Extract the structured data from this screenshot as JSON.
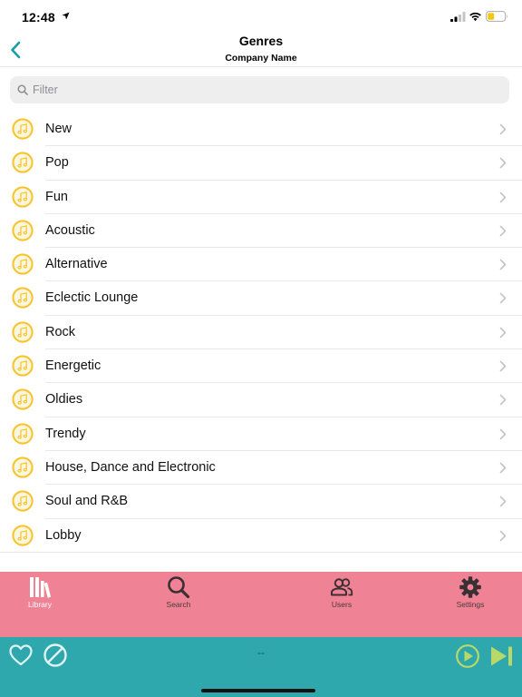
{
  "status_bar": {
    "time": "12:48"
  },
  "nav": {
    "title": "Genres",
    "subtitle": "Company Name"
  },
  "filter": {
    "placeholder": "Filter",
    "value": ""
  },
  "genres": [
    {
      "label": "New"
    },
    {
      "label": "Pop"
    },
    {
      "label": "Fun"
    },
    {
      "label": "Acoustic"
    },
    {
      "label": "Alternative"
    },
    {
      "label": "Eclectic Lounge"
    },
    {
      "label": "Rock"
    },
    {
      "label": "Energetic"
    },
    {
      "label": "Oldies"
    },
    {
      "label": "Trendy"
    },
    {
      "label": "House, Dance and Electronic"
    },
    {
      "label": "Soul and R&B"
    },
    {
      "label": "Lobby"
    }
  ],
  "tab_bar": {
    "items": [
      {
        "label": "Library",
        "icon": "library-icon",
        "selected": true
      },
      {
        "label": "Search",
        "icon": "search-icon",
        "selected": false
      },
      {
        "label": "Users",
        "icon": "users-icon",
        "selected": false
      },
      {
        "label": "Settings",
        "icon": "gear-icon",
        "selected": false
      }
    ]
  },
  "player": {
    "now_playing": "--"
  },
  "colors": {
    "accent": "#1a9ea6",
    "icon_yellow": "#f5c531",
    "tab_bar_bg": "#f08295",
    "player_bg": "#2ea8ad",
    "player_green": "#b8d868"
  }
}
